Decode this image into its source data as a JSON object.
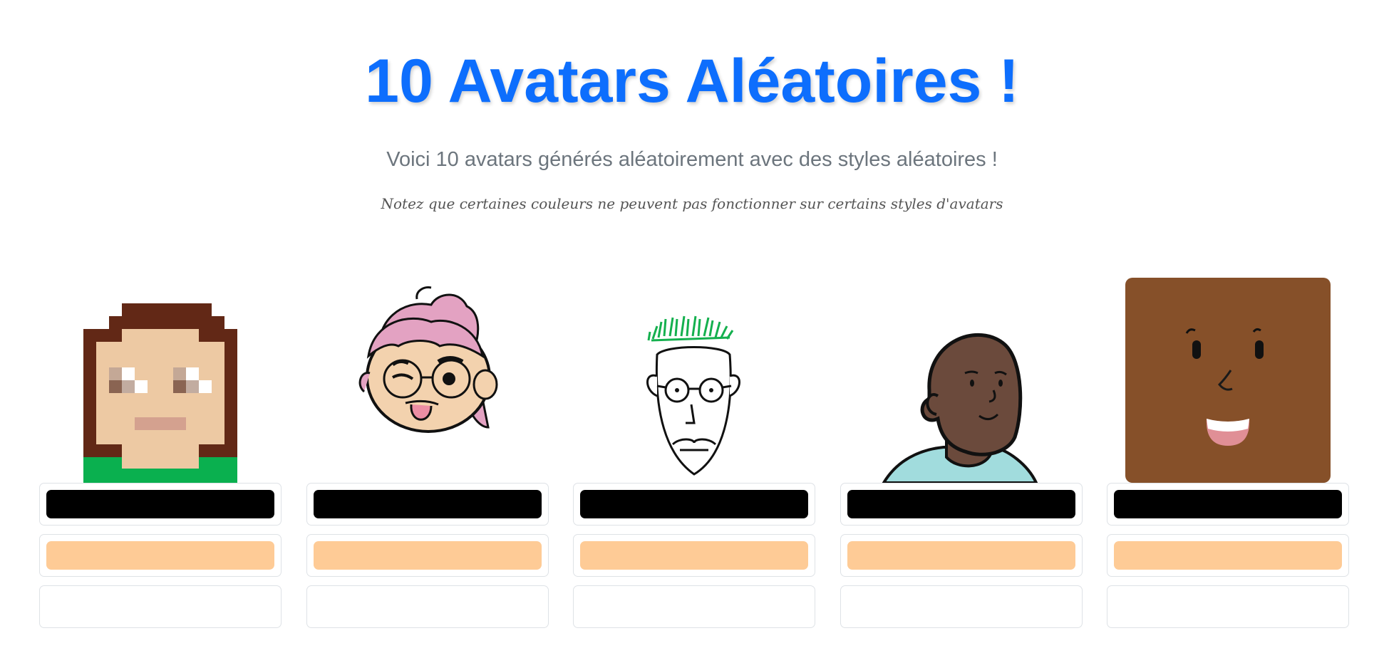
{
  "header": {
    "title": "10 Avatars Aléatoires !",
    "subtitle": "Voici 10 avatars générés aléatoirement avec des styles aléatoires !",
    "note": "Notez que certaines couleurs ne peuvent pas fonctionner sur certains styles d'avatars"
  },
  "avatars": [
    {
      "style_icon": "pixel-art-avatar-icon",
      "color_1": "#000000",
      "color_2": "#fecb96",
      "color_3": "#ffffff"
    },
    {
      "style_icon": "winking-girl-avatar-icon",
      "color_1": "#000000",
      "color_2": "#fecb96",
      "color_3": "#ffffff"
    },
    {
      "style_icon": "sketch-man-avatar-icon",
      "color_1": "#000000",
      "color_2": "#fecb96",
      "color_3": "#ffffff"
    },
    {
      "style_icon": "bald-person-avatar-icon",
      "color_1": "#000000",
      "color_2": "#fecb96",
      "color_3": "#ffffff"
    },
    {
      "style_icon": "square-face-avatar-icon",
      "color_1": "#000000",
      "color_2": "#fecb96",
      "color_3": "#ffffff"
    }
  ]
}
